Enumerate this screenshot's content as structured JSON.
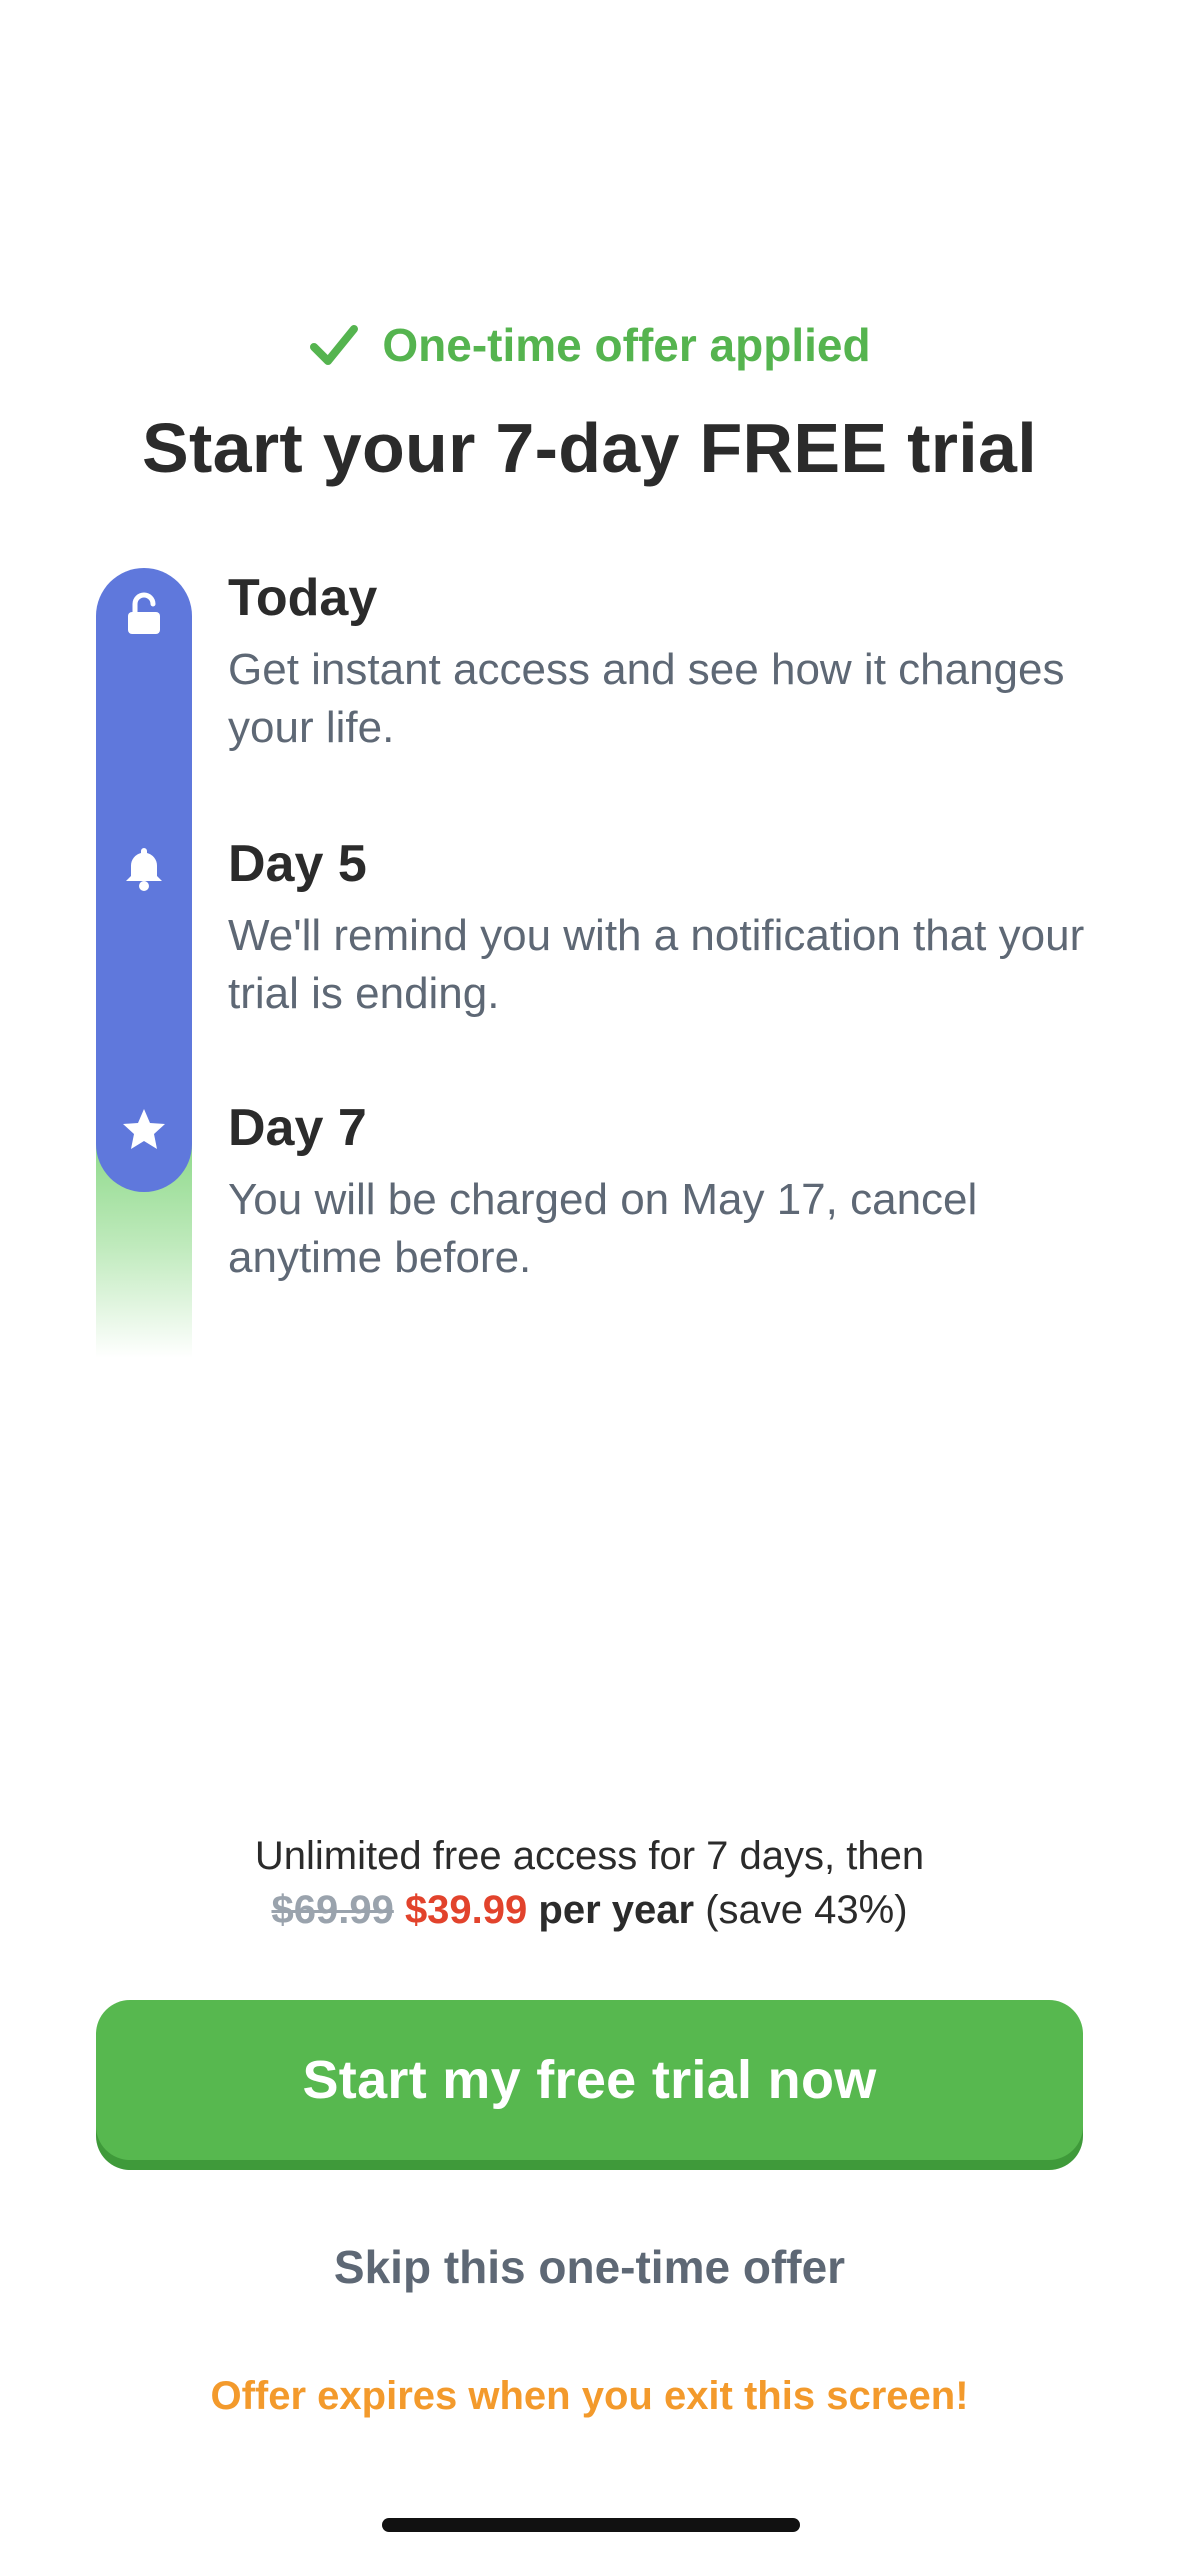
{
  "header": {
    "offer_applied": "One-time offer applied",
    "title": "Start your 7-day FREE trial"
  },
  "timeline": {
    "steps": [
      {
        "icon": "unlock-icon",
        "title": "Today",
        "description": "Get instant access and see how it changes your life."
      },
      {
        "icon": "bell-icon",
        "title": "Day 5",
        "description": "We'll remind you with a notification that your trial is ending."
      },
      {
        "icon": "star-icon",
        "title": "Day 7",
        "description": "You will be charged on May 17, cancel anytime before."
      }
    ]
  },
  "pricing": {
    "line1": "Unlimited free access for 7 days, then",
    "old_price": "$69.99",
    "new_price": "$39.99",
    "period": "per year",
    "savings": "(save 43%)"
  },
  "cta": {
    "label": "Start my free trial now"
  },
  "skip": {
    "label": "Skip this one-time offer"
  },
  "expiry": {
    "note": "Offer expires when you exit this screen!"
  },
  "colors": {
    "accent_green": "#57b84f",
    "timeline_blue": "#5f78dc",
    "price_red": "#e2432c",
    "warning_orange": "#f39a2c",
    "muted_gray": "#5e6875"
  }
}
